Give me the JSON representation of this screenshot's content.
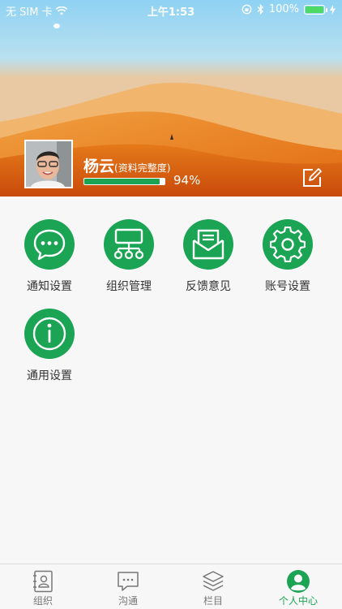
{
  "status_bar": {
    "carrier": "无 SIM 卡",
    "time": "上午1:53",
    "battery": "100%"
  },
  "profile": {
    "name": "杨云",
    "completeness_label": "(资料完整度)",
    "completeness_percent_text": "94%",
    "completeness_fraction": 0.94
  },
  "menu": {
    "items": [
      {
        "label": "通知设置",
        "icon": "chat-bubble-icon"
      },
      {
        "label": "组织管理",
        "icon": "org-chart-icon"
      },
      {
        "label": "反馈意见",
        "icon": "envelope-icon"
      },
      {
        "label": "账号设置",
        "icon": "gear-icon"
      },
      {
        "label": "通用设置",
        "icon": "info-icon"
      }
    ]
  },
  "tabbar": {
    "tabs": [
      {
        "label": "组织",
        "icon": "contacts-book-icon"
      },
      {
        "label": "沟通",
        "icon": "message-icon"
      },
      {
        "label": "栏目",
        "icon": "layers-icon"
      },
      {
        "label": "个人中心",
        "icon": "person-icon"
      }
    ],
    "active_index": 3
  },
  "colors": {
    "accent": "#1aa453",
    "background": "#f7f7f7",
    "text": "#333333"
  }
}
